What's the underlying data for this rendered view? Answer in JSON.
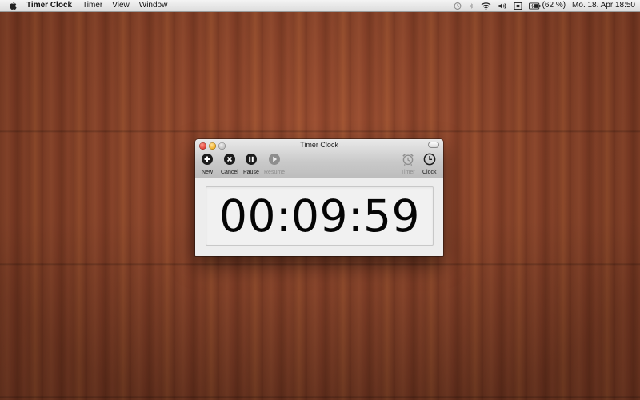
{
  "menubar": {
    "app_name": "Timer Clock",
    "menus": [
      "Timer",
      "View",
      "Window"
    ],
    "battery": "(62 %)",
    "datetime": "Mo. 18. Apr  18:50"
  },
  "window": {
    "title": "Timer Clock",
    "toolbar": {
      "new": "New",
      "cancel": "Cancel",
      "pause": "Pause",
      "resume": "Resume",
      "timer": "Timer",
      "clock": "Clock"
    },
    "display": "00:09:59"
  },
  "colors": {
    "desktop_wood": "#8a3f27",
    "display_text": "#050505",
    "disabled_label": "#8c8c8c"
  }
}
